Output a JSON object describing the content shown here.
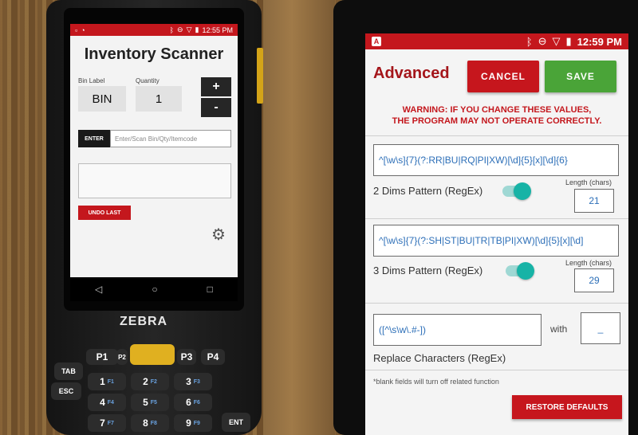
{
  "left_device": {
    "status_time": "12:55 PM",
    "title": "Inventory Scanner",
    "bin_label": "Bin Label",
    "bin_value": "BIN",
    "quantity_label": "Quantity",
    "quantity_value": "1",
    "plus": "+",
    "minus": "-",
    "enter_label": "ENTER",
    "enter_placeholder": "Enter/Scan Bin/Qty/Itemcode",
    "undo_label": "UNDO LAST",
    "brand": "ZEBRA",
    "keys": [
      {
        "label": "1",
        "sub": "F1"
      },
      {
        "label": "2",
        "sub": "F2"
      },
      {
        "label": "3",
        "sub": "F3"
      },
      {
        "label": "4",
        "sub": "F4"
      },
      {
        "label": "5",
        "sub": "F5"
      },
      {
        "label": "6",
        "sub": "F6"
      },
      {
        "label": "7",
        "sub": "F7"
      },
      {
        "label": "8",
        "sub": "F8"
      },
      {
        "label": "9",
        "sub": "F9"
      }
    ],
    "side_keys": {
      "tab": "TAB",
      "esc": "ESC",
      "ent": "ENT",
      "p1": "P1",
      "p2": "P2",
      "p3": "P3",
      "p4": "P4"
    }
  },
  "right_device": {
    "status_time": "12:59 PM",
    "status_a": "A",
    "title": "Advanced",
    "cancel_label": "CANCEL",
    "save_label": "SAVE",
    "warning_line1": "WARNING: IF YOU CHANGE THESE VALUES,",
    "warning_line2": "THE PROGRAM MAY NOT OPERATE CORRECTLY.",
    "pattern2": {
      "value": "^[\\w\\s]{7}(?:RR|BU|RQ|PI|XW)[\\d]{5}[x][\\d]{6}",
      "label": "2 Dims Pattern (RegEx)",
      "enabled": true,
      "length_label": "Length (chars)",
      "length_value": "21"
    },
    "pattern3": {
      "value": "^[\\w\\s]{7}(?:SH|ST|BU|TR|TB|PI|XW)[\\d]{5}[x][\\d]",
      "label": "3 Dims Pattern (RegEx)",
      "enabled": true,
      "length_label": "Length (chars)",
      "length_value": "29"
    },
    "replace": {
      "value": "([^\\s\\w\\.#-])",
      "with_label": "with",
      "with_value": "_",
      "label": "Replace Characters (RegEx)"
    },
    "note": "*blank fields will turn off related function",
    "restore_label": "RESTORE DEFAULTS",
    "colors": {
      "accent": "#c6161d",
      "save": "#4aa438",
      "toggle": "#17b3a6",
      "value_text": "#2d6fb8"
    }
  }
}
